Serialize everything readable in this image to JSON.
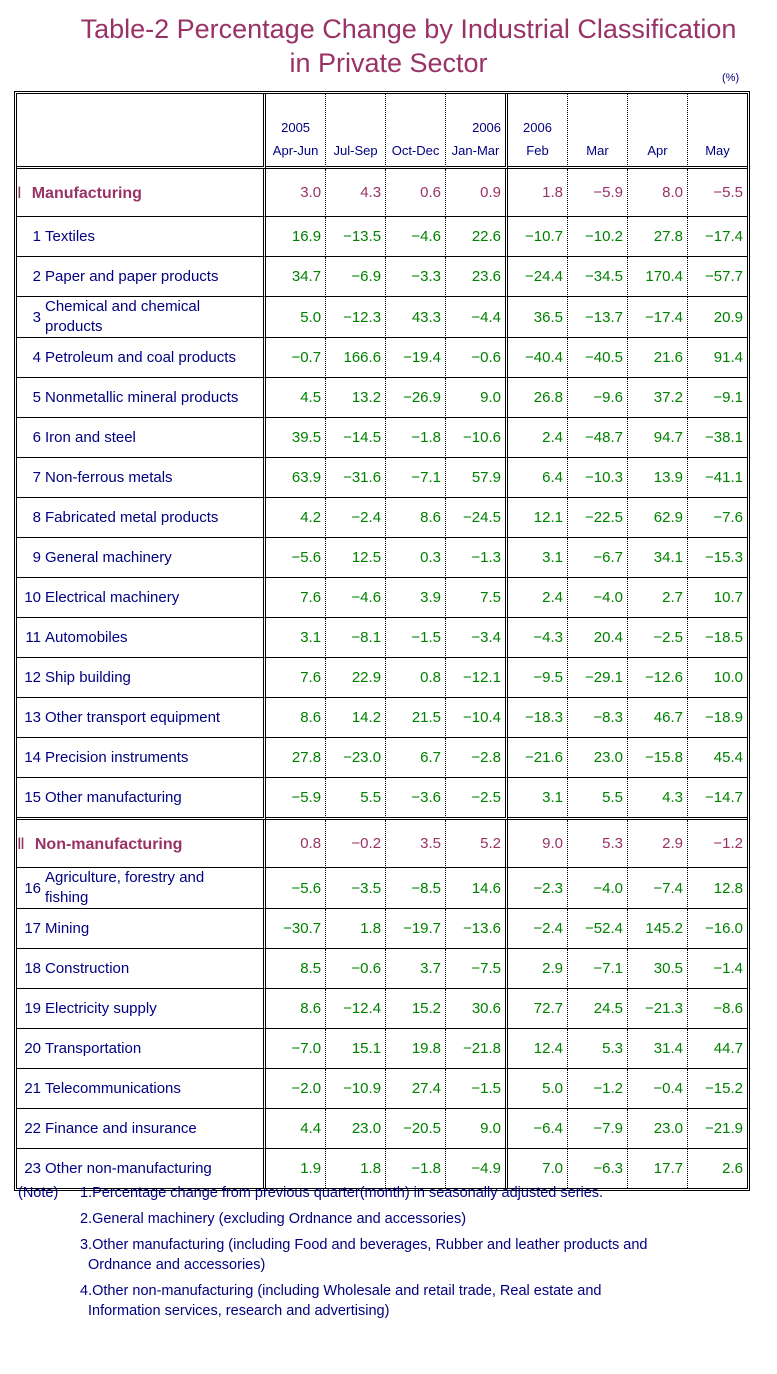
{
  "title": {
    "line1": "Table-2   Percentage Change by Industrial Classification",
    "line2": "in Private Sector"
  },
  "unit": "(%)",
  "columns": [
    {
      "year": "2005",
      "period": "Apr-Jun"
    },
    {
      "year": "",
      "period": "Jul-Sep"
    },
    {
      "year": "",
      "period": "Oct-Dec"
    },
    {
      "year": "2006",
      "period": "Jan-Mar"
    },
    {
      "year": "2006",
      "period": "Feb"
    },
    {
      "year": "",
      "period": "Mar"
    },
    {
      "year": "",
      "period": "Apr"
    },
    {
      "year": "",
      "period": "May"
    }
  ],
  "sections": [
    {
      "roman": "Ⅰ",
      "label": "Manufacturing",
      "values": [
        "3.0",
        "4.3",
        "0.6",
        "0.9",
        "1.8",
        "−5.9",
        "8.0",
        "−5.5"
      ],
      "items": [
        {
          "no": "1",
          "label": "Textiles",
          "values": [
            "16.9",
            "−13.5",
            "−4.6",
            "22.6",
            "−10.7",
            "−10.2",
            "27.8",
            "−17.4"
          ]
        },
        {
          "no": "2",
          "label": "Paper and paper products",
          "values": [
            "34.7",
            "−6.9",
            "−3.3",
            "23.6",
            "−24.4",
            "−34.5",
            "170.4",
            "−57.7"
          ]
        },
        {
          "no": "3",
          "label": "Chemical and chemical products",
          "values": [
            "5.0",
            "−12.3",
            "43.3",
            "−4.4",
            "36.5",
            "−13.7",
            "−17.4",
            "20.9"
          ]
        },
        {
          "no": "4",
          "label": "Petroleum and coal products",
          "values": [
            "−0.7",
            "166.6",
            "−19.4",
            "−0.6",
            "−40.4",
            "−40.5",
            "21.6",
            "91.4"
          ]
        },
        {
          "no": "5",
          "label": "Nonmetallic mineral products",
          "values": [
            "4.5",
            "13.2",
            "−26.9",
            "9.0",
            "26.8",
            "−9.6",
            "37.2",
            "−9.1"
          ]
        },
        {
          "no": "6",
          "label": "Iron and steel",
          "values": [
            "39.5",
            "−14.5",
            "−1.8",
            "−10.6",
            "2.4",
            "−48.7",
            "94.7",
            "−38.1"
          ]
        },
        {
          "no": "7",
          "label": "Non-ferrous metals",
          "values": [
            "63.9",
            "−31.6",
            "−7.1",
            "57.9",
            "6.4",
            "−10.3",
            "13.9",
            "−41.1"
          ]
        },
        {
          "no": "8",
          "label": "Fabricated metal products",
          "values": [
            "4.2",
            "−2.4",
            "8.6",
            "−24.5",
            "12.1",
            "−22.5",
            "62.9",
            "−7.6"
          ]
        },
        {
          "no": "9",
          "label": "General machinery",
          "values": [
            "−5.6",
            "12.5",
            "0.3",
            "−1.3",
            "3.1",
            "−6.7",
            "34.1",
            "−15.3"
          ]
        },
        {
          "no": "10",
          "label": "Electrical machinery",
          "values": [
            "7.6",
            "−4.6",
            "3.9",
            "7.5",
            "2.4",
            "−4.0",
            "2.7",
            "10.7"
          ]
        },
        {
          "no": "11",
          "label": "Automobiles",
          "values": [
            "3.1",
            "−8.1",
            "−1.5",
            "−3.4",
            "−4.3",
            "20.4",
            "−2.5",
            "−18.5"
          ]
        },
        {
          "no": "12",
          "label": "Ship building",
          "values": [
            "7.6",
            "22.9",
            "0.8",
            "−12.1",
            "−9.5",
            "−29.1",
            "−12.6",
            "10.0"
          ]
        },
        {
          "no": "13",
          "label": "Other transport equipment",
          "values": [
            "8.6",
            "14.2",
            "21.5",
            "−10.4",
            "−18.3",
            "−8.3",
            "46.7",
            "−18.9"
          ]
        },
        {
          "no": "14",
          "label": "Precision instruments",
          "values": [
            "27.8",
            "−23.0",
            "6.7",
            "−2.8",
            "−21.6",
            "23.0",
            "−15.8",
            "45.4"
          ]
        },
        {
          "no": "15",
          "label": "Other manufacturing",
          "values": [
            "−5.9",
            "5.5",
            "−3.6",
            "−2.5",
            "3.1",
            "5.5",
            "4.3",
            "−14.7"
          ]
        }
      ]
    },
    {
      "roman": "Ⅱ",
      "label": "Non-manufacturing",
      "values": [
        "0.8",
        "−0.2",
        "3.5",
        "5.2",
        "9.0",
        "5.3",
        "2.9",
        "−1.2"
      ],
      "items": [
        {
          "no": "16",
          "label": "Agriculture, forestry and fishing",
          "values": [
            "−5.6",
            "−3.5",
            "−8.5",
            "14.6",
            "−2.3",
            "−4.0",
            "−7.4",
            "12.8"
          ]
        },
        {
          "no": "17",
          "label": "Mining",
          "values": [
            "−30.7",
            "1.8",
            "−19.7",
            "−13.6",
            "−2.4",
            "−52.4",
            "145.2",
            "−16.0"
          ]
        },
        {
          "no": "18",
          "label": "Construction",
          "values": [
            "8.5",
            "−0.6",
            "3.7",
            "−7.5",
            "2.9",
            "−7.1",
            "30.5",
            "−1.4"
          ]
        },
        {
          "no": "19",
          "label": "Electricity supply",
          "values": [
            "8.6",
            "−12.4",
            "15.2",
            "30.6",
            "72.7",
            "24.5",
            "−21.3",
            "−8.6"
          ]
        },
        {
          "no": "20",
          "label": "Transportation",
          "values": [
            "−7.0",
            "15.1",
            "19.8",
            "−21.8",
            "12.4",
            "5.3",
            "31.4",
            "44.7"
          ]
        },
        {
          "no": "21",
          "label": "Telecommunications",
          "values": [
            "−2.0",
            "−10.9",
            "27.4",
            "−1.5",
            "5.0",
            "−1.2",
            "−0.4",
            "−15.2"
          ]
        },
        {
          "no": "22",
          "label": "Finance and insurance",
          "values": [
            "4.4",
            "23.0",
            "−20.5",
            "9.0",
            "−6.4",
            "−7.9",
            "23.0",
            "−21.9"
          ]
        },
        {
          "no": "23",
          "label": "Other non-manufacturing",
          "values": [
            "1.9",
            "1.8",
            "−1.8",
            "−4.9",
            "7.0",
            "−6.3",
            "17.7",
            "2.6"
          ]
        }
      ]
    }
  ],
  "notes": {
    "head": "(Note)",
    "items": [
      {
        "line1": "1.Percentage change from previous quarter(month) in seasonally adjusted series.",
        "line2": ""
      },
      {
        "line1": "2.General machinery (excluding Ordnance and accessories)",
        "line2": ""
      },
      {
        "line1": "3.Other manufacturing (including Food and beverages, Rubber and leather products and",
        "line2": "Ordnance and accessories)"
      },
      {
        "line1": "4.Other non-manufacturing (including Wholesale and retail trade, Real estate and",
        "line2": "Information services, research and advertising)"
      }
    ]
  },
  "colors": {
    "title": "#993366",
    "section": "#993366",
    "label": "#000080",
    "value": "#008000"
  }
}
